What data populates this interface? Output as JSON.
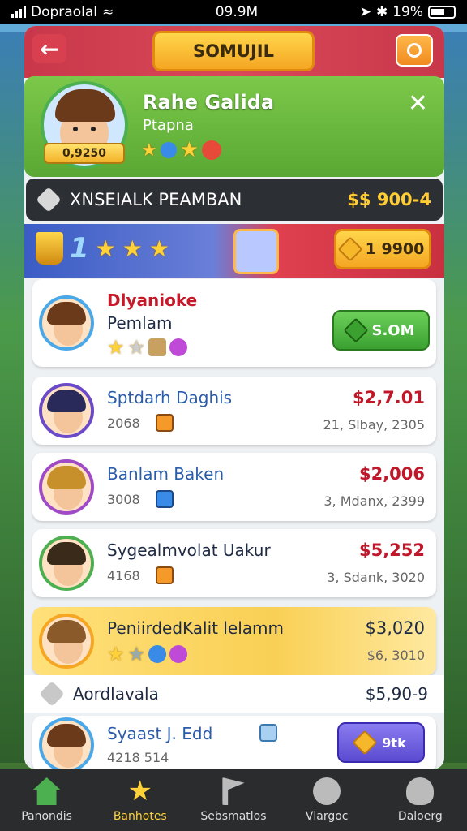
{
  "status_bar": {
    "carrier": "Dopraolal",
    "time": "09.9M",
    "battery_text": "19%"
  },
  "top_bar": {
    "title": "SOMUJIL"
  },
  "profile": {
    "name": "Rahe Galida",
    "subtitle": "Ptapna",
    "score": "0,9250"
  },
  "banner": {
    "label": "XNSEIALK PEAMBAN",
    "value": "$$ 900-4"
  },
  "rank": {
    "number": "1",
    "coins": "1 9900"
  },
  "featured": {
    "name_line1": "Dlyanioke",
    "name_line2": "Pemlam",
    "button_label": "S.OM"
  },
  "rows": [
    {
      "name": "Sptdarh Daghis",
      "sub": "2068",
      "price": "$2,7.01",
      "meta": "21, Slbay, 2305"
    },
    {
      "name": "Banlam Baken",
      "sub": "3008",
      "price": "$2,006",
      "meta": "3, Mdanx, 2399"
    },
    {
      "name": "Sygealmvolat Uakur",
      "sub": "4168",
      "price": "$5,252",
      "meta": "3, Sdank, 3020"
    },
    {
      "name": "PeniirdedKalit lelamm",
      "sub": "",
      "price": "$3,020",
      "meta": "$6, 3010"
    }
  ],
  "plain_row": {
    "label": "Aordlavala",
    "value": "$5,90-9"
  },
  "last_row": {
    "name": "Syaast J. Edd",
    "sub": "4218  514",
    "button_label": "9tk"
  },
  "nav": [
    {
      "label": "Panondis",
      "icon": "home-icon"
    },
    {
      "label": "Banhotes",
      "icon": "star-icon"
    },
    {
      "label": "Sebsmatlos",
      "icon": "flag-icon"
    },
    {
      "label": "Vlargoc",
      "icon": "gift-icon"
    },
    {
      "label": "Daloerg",
      "icon": "profile-icon"
    }
  ],
  "colors": {
    "accent_red": "#c8384a",
    "accent_green": "#5aa834",
    "accent_gold": "#f5a623"
  }
}
